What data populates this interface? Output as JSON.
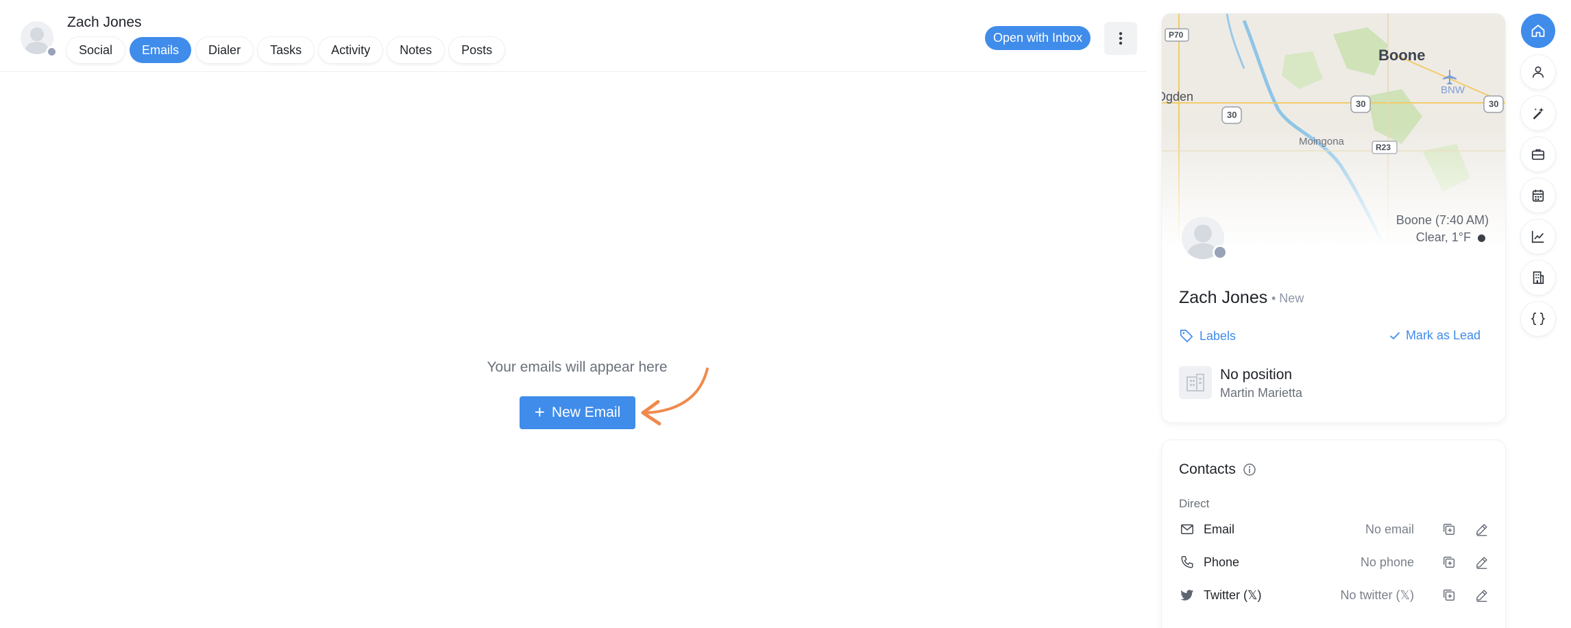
{
  "header": {
    "contact_name": "Zach Jones",
    "tabs": [
      {
        "label": "Social",
        "active": false
      },
      {
        "label": "Emails",
        "active": true
      },
      {
        "label": "Dialer",
        "active": false
      },
      {
        "label": "Tasks",
        "active": false
      },
      {
        "label": "Activity",
        "active": false
      },
      {
        "label": "Notes",
        "active": false
      },
      {
        "label": "Posts",
        "active": false
      }
    ],
    "open_inbox_label": "Open with Inbox"
  },
  "emails": {
    "empty_text": "Your emails will appear here",
    "new_email_label": "New Email"
  },
  "profile": {
    "map": {
      "city": "Boone",
      "labels": {
        "road_p70": "P70",
        "ogden": "Ogden",
        "us30_a": "30",
        "us30_b": "30",
        "us30_c": "30",
        "bnw": "BNW",
        "moingona": "Moingona",
        "r23": "R23"
      }
    },
    "location_time": "Boone (7:40 AM)",
    "weather": "Clear, 1°F",
    "name": "Zach Jones",
    "status": "• New",
    "labels_link": "Labels",
    "mark_lead_link": "Mark as Lead",
    "position": "No position",
    "company": "Martin Marietta"
  },
  "contacts": {
    "title": "Contacts",
    "section_label": "Direct",
    "rows": [
      {
        "label": "Email",
        "value": "No email",
        "icon": "mail-icon"
      },
      {
        "label": "Phone",
        "value": "No phone",
        "icon": "phone-icon"
      },
      {
        "label": "Twitter (𝕏)",
        "value": "No twitter (𝕏)",
        "icon": "twitter-icon"
      }
    ]
  },
  "rail": [
    "home-icon",
    "user-icon",
    "magic-wand-icon",
    "briefcase-icon",
    "calendar-icon",
    "chart-icon",
    "building-icon",
    "code-braces-icon"
  ],
  "colors": {
    "accent": "#3f8ceb",
    "arrow": "#ef8a4c",
    "status_dot": "#98a2b8"
  }
}
